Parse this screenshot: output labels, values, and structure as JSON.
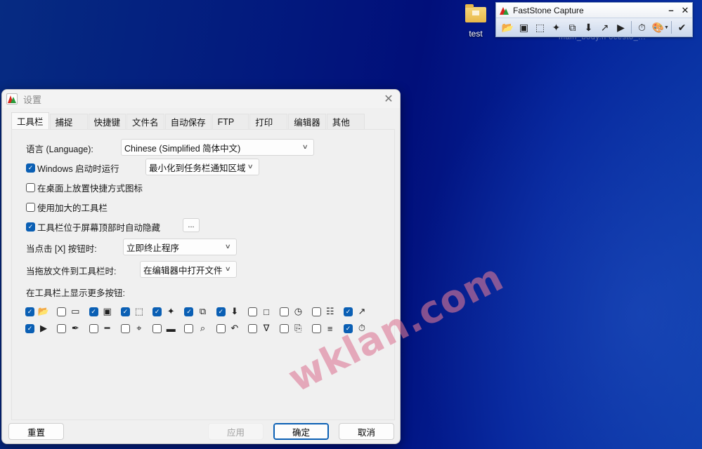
{
  "desktop": {
    "icon_label": "test",
    "behind_text": "main_body.h  ocesto_..."
  },
  "faststone_toolbar": {
    "title": "FastStone Capture",
    "minimize_label": "–",
    "close_label": "✕",
    "tools": [
      {
        "name": "open-file-icon",
        "glyph": "📂"
      },
      {
        "name": "capture-window-icon",
        "glyph": "▣"
      },
      {
        "name": "capture-rect-region-icon",
        "glyph": "⬚"
      },
      {
        "name": "capture-freehand-icon",
        "glyph": "✦"
      },
      {
        "name": "capture-fullscreen-icon",
        "glyph": "⧉"
      },
      {
        "name": "capture-scrolling-icon",
        "glyph": "⬇"
      },
      {
        "name": "output-icon",
        "glyph": "↗"
      },
      {
        "name": "screen-recorder-icon",
        "glyph": "▶"
      },
      {
        "name": "delay-timer-icon",
        "glyph": "⏱"
      },
      {
        "name": "color-palette-icon",
        "glyph": "🎨"
      },
      {
        "name": "settings-menu-icon",
        "glyph": "✔"
      }
    ]
  },
  "dialog": {
    "title": "设置",
    "close_label": "✕",
    "tabs": [
      "工具栏",
      "捕捉",
      "快捷键",
      "文件名",
      "自动保存",
      "FTP",
      "打印",
      "编辑器",
      "其他"
    ],
    "active_tab": "工具栏",
    "language": {
      "label": "语言 (Language):",
      "value": "Chinese (Simplified 简体中文)"
    },
    "run_on_startup": {
      "label": "Windows 启动时运行",
      "checked": true,
      "mode_value": "最小化到任务栏通知区域"
    },
    "desktop_shortcut": {
      "label": "在桌面上放置快捷方式图标",
      "checked": false
    },
    "large_toolbar": {
      "label": "使用加大的工具栏",
      "checked": false
    },
    "auto_hide": {
      "label": "工具栏位于屏幕顶部时自动隐藏",
      "checked": true,
      "more_label": "..."
    },
    "on_close": {
      "label": "当点击 [X] 按钮时:",
      "value": "立即终止程序"
    },
    "on_drop": {
      "label": "当拖放文件到工具栏时:",
      "value": "在编辑器中打开文件"
    },
    "more_buttons_label": "在工具栏上显示更多按钮:",
    "toolbar_buttons": [
      [
        {
          "name": "open-file-icon",
          "glyph": "📂",
          "checked": true
        },
        {
          "name": "capture-active-window-icon",
          "glyph": "▭",
          "checked": false
        },
        {
          "name": "capture-window-object-icon",
          "glyph": "▣",
          "checked": true
        },
        {
          "name": "capture-rect-region-icon",
          "glyph": "⬚",
          "checked": true
        },
        {
          "name": "capture-freehand-icon",
          "glyph": "✦",
          "checked": true
        },
        {
          "name": "capture-fullscreen-icon",
          "glyph": "⧉",
          "checked": true
        },
        {
          "name": "capture-scrolling-icon",
          "glyph": "⬇",
          "checked": true
        },
        {
          "name": "capture-fixed-region-icon",
          "glyph": "□",
          "checked": false
        },
        {
          "name": "delayed-capture-clock-icon",
          "glyph": "◷",
          "checked": false
        },
        {
          "name": "text-capture-icon",
          "glyph": "☷",
          "checked": false
        },
        {
          "name": "output-icon",
          "glyph": "↗",
          "checked": true
        }
      ],
      [
        {
          "name": "screen-recorder-icon",
          "glyph": "▶",
          "checked": true
        },
        {
          "name": "color-picker-icon",
          "glyph": "✒",
          "checked": false
        },
        {
          "name": "screen-ruler-icon",
          "glyph": "━",
          "checked": false
        },
        {
          "name": "crosshair-icon",
          "glyph": "⌖",
          "checked": false
        },
        {
          "name": "horizontal-bar-icon",
          "glyph": "▬",
          "checked": false
        },
        {
          "name": "magnifier-icon",
          "glyph": "⌕",
          "checked": false
        },
        {
          "name": "undo-arrow-icon",
          "glyph": "↶",
          "checked": false
        },
        {
          "name": "scanner-icon",
          "glyph": "∇",
          "checked": false
        },
        {
          "name": "pdf-icon",
          "glyph": "⎘",
          "checked": false
        },
        {
          "name": "join-images-icon",
          "glyph": "≡",
          "checked": false
        },
        {
          "name": "timer-icon",
          "glyph": "⏱",
          "checked": true
        }
      ]
    ],
    "buttons": {
      "reset": "重置",
      "apply": "应用",
      "ok": "确定",
      "cancel": "取消"
    }
  },
  "watermark": "wklan.com"
}
